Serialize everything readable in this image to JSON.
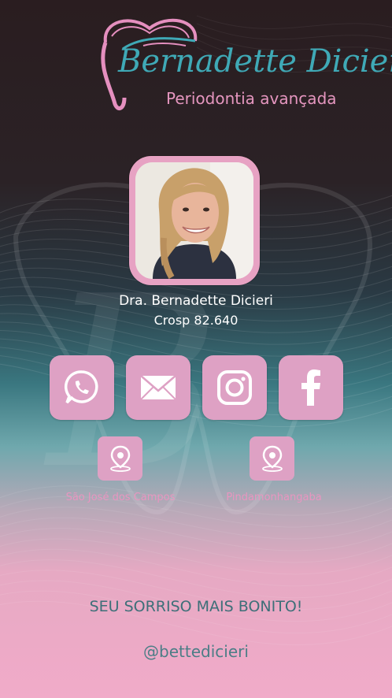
{
  "brand": {
    "name": "Bernadette Dicieri",
    "subtitle": "Periodontia avançada"
  },
  "profile": {
    "name": "Dra. Bernadette Dicieri",
    "registration": "Crosp 82.640"
  },
  "social": [
    {
      "icon": "whatsapp-icon"
    },
    {
      "icon": "email-icon"
    },
    {
      "icon": "instagram-icon"
    },
    {
      "icon": "facebook-icon"
    }
  ],
  "locations": [
    {
      "label": "São José dos Campos",
      "icon": "location-pin-icon"
    },
    {
      "label": "Pindamonhangaba",
      "icon": "location-pin-icon"
    }
  ],
  "slogan": "SEU SORRISO MAIS BONITO!",
  "handle": "@bettedicieri",
  "colors": {
    "accent_pink": "#dea1c4",
    "brand_teal": "#3fa9b6",
    "subtitle_pink": "#e596bf",
    "slogan_teal": "#3d6f78"
  }
}
